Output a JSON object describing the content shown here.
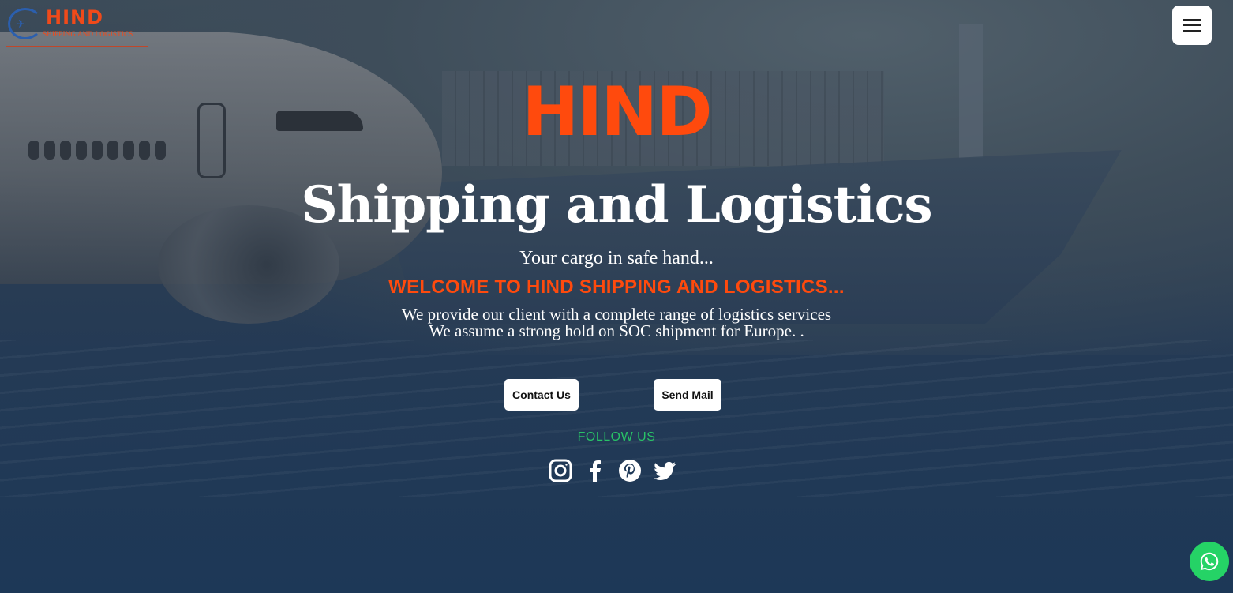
{
  "logo": {
    "title": "HIND",
    "subtitle": "SHIPPING AND LOGISTICS"
  },
  "menu": {
    "icon": "hamburger-icon"
  },
  "hero": {
    "brand": "HIND",
    "headline": "Shipping and Logistics",
    "tagline": "Your cargo in safe hand...",
    "welcome": "WELCOME TO HIND SHIPPING AND LOGISTICS...",
    "description_line1": "We provide our client with a complete range of logistics services",
    "description_line2": "We assume a strong hold on SOC shipment for Europe. ."
  },
  "buttons": {
    "contact_label": "Contact Us",
    "mail_label": "Send Mail"
  },
  "social": {
    "follow_label": "FOLLOW US",
    "icons": [
      "instagram-icon",
      "facebook-icon",
      "pinterest-icon",
      "twitter-icon"
    ]
  },
  "floating": {
    "icon": "whatsapp-icon"
  },
  "colors": {
    "accent": "#ff4a0d",
    "follow": "#29c267",
    "whatsapp": "#25d366"
  }
}
